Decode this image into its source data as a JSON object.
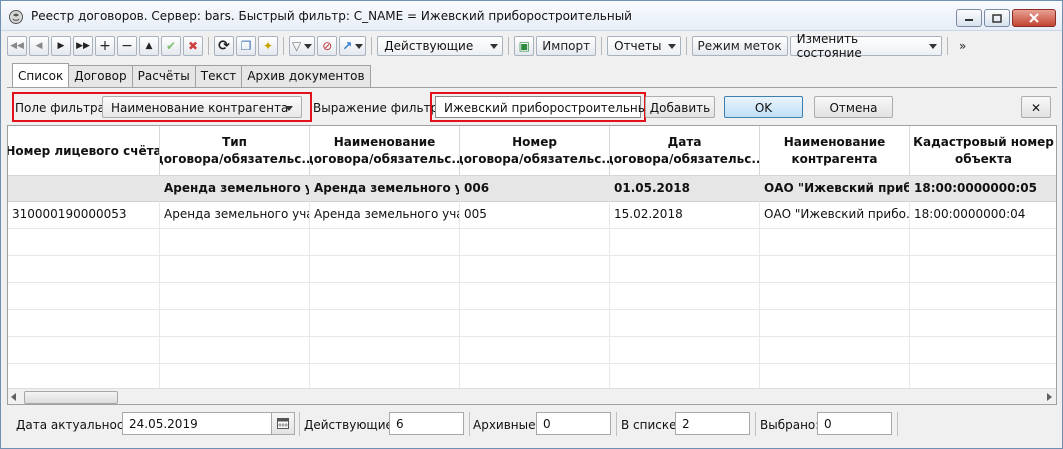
{
  "window": {
    "title": "Реестр договоров. Сервер: bars. Быстрый фильтр: C_NAME = Ижевский приборостроительный"
  },
  "toolbar": {
    "status_combo": "Действующие",
    "import_label": "Импорт",
    "reports_label": "Отчеты",
    "marks_mode_label": "Режим меток",
    "change_state_label": "Изменить состояние",
    "more_label": "»"
  },
  "tabs": [
    "Список",
    "Договор",
    "Расчёты",
    "Текст",
    "Архив документов"
  ],
  "filter": {
    "field_label": "Поле фильтра",
    "field_value": "Наименование контрагента",
    "expression_label": "Выражение фильтра",
    "expression_value": "Ижевский приборостроительный",
    "add_label": "Добавить",
    "ok_label": "OK",
    "cancel_label": "Отмена",
    "close_label": "✕"
  },
  "grid": {
    "headers": [
      "Номер лицевого счёта",
      "Тип договора/обязательс...",
      "Наименование договора/обязательс...",
      "Номер договора/обязательс...",
      "Дата договора/обязательс...",
      "Наименование контрагента",
      "Кадастровый номер объекта"
    ],
    "summary": [
      "",
      "Аренда земельного у...",
      "Аренда земельного у...",
      "006",
      "01.05.2018",
      "ОАО \"Ижевский приб...",
      "18:00:0000000:05"
    ],
    "rows": [
      [
        "310000190000053",
        "Аренда земельного уча...",
        "Аренда земельного уча...",
        "005",
        "15.02.2018",
        "ОАО \"Ижевский прибо...",
        "18:00:0000000:04"
      ]
    ]
  },
  "status": {
    "date_label": "Дата актуальности",
    "date_value": "24.05.2019",
    "active_label": "Действующие:",
    "active_value": "6",
    "archived_label": "Архивные:",
    "archived_value": "0",
    "inlist_label": "В списке:",
    "inlist_value": "2",
    "selected_label": "Выбрано:",
    "selected_value": "0"
  }
}
